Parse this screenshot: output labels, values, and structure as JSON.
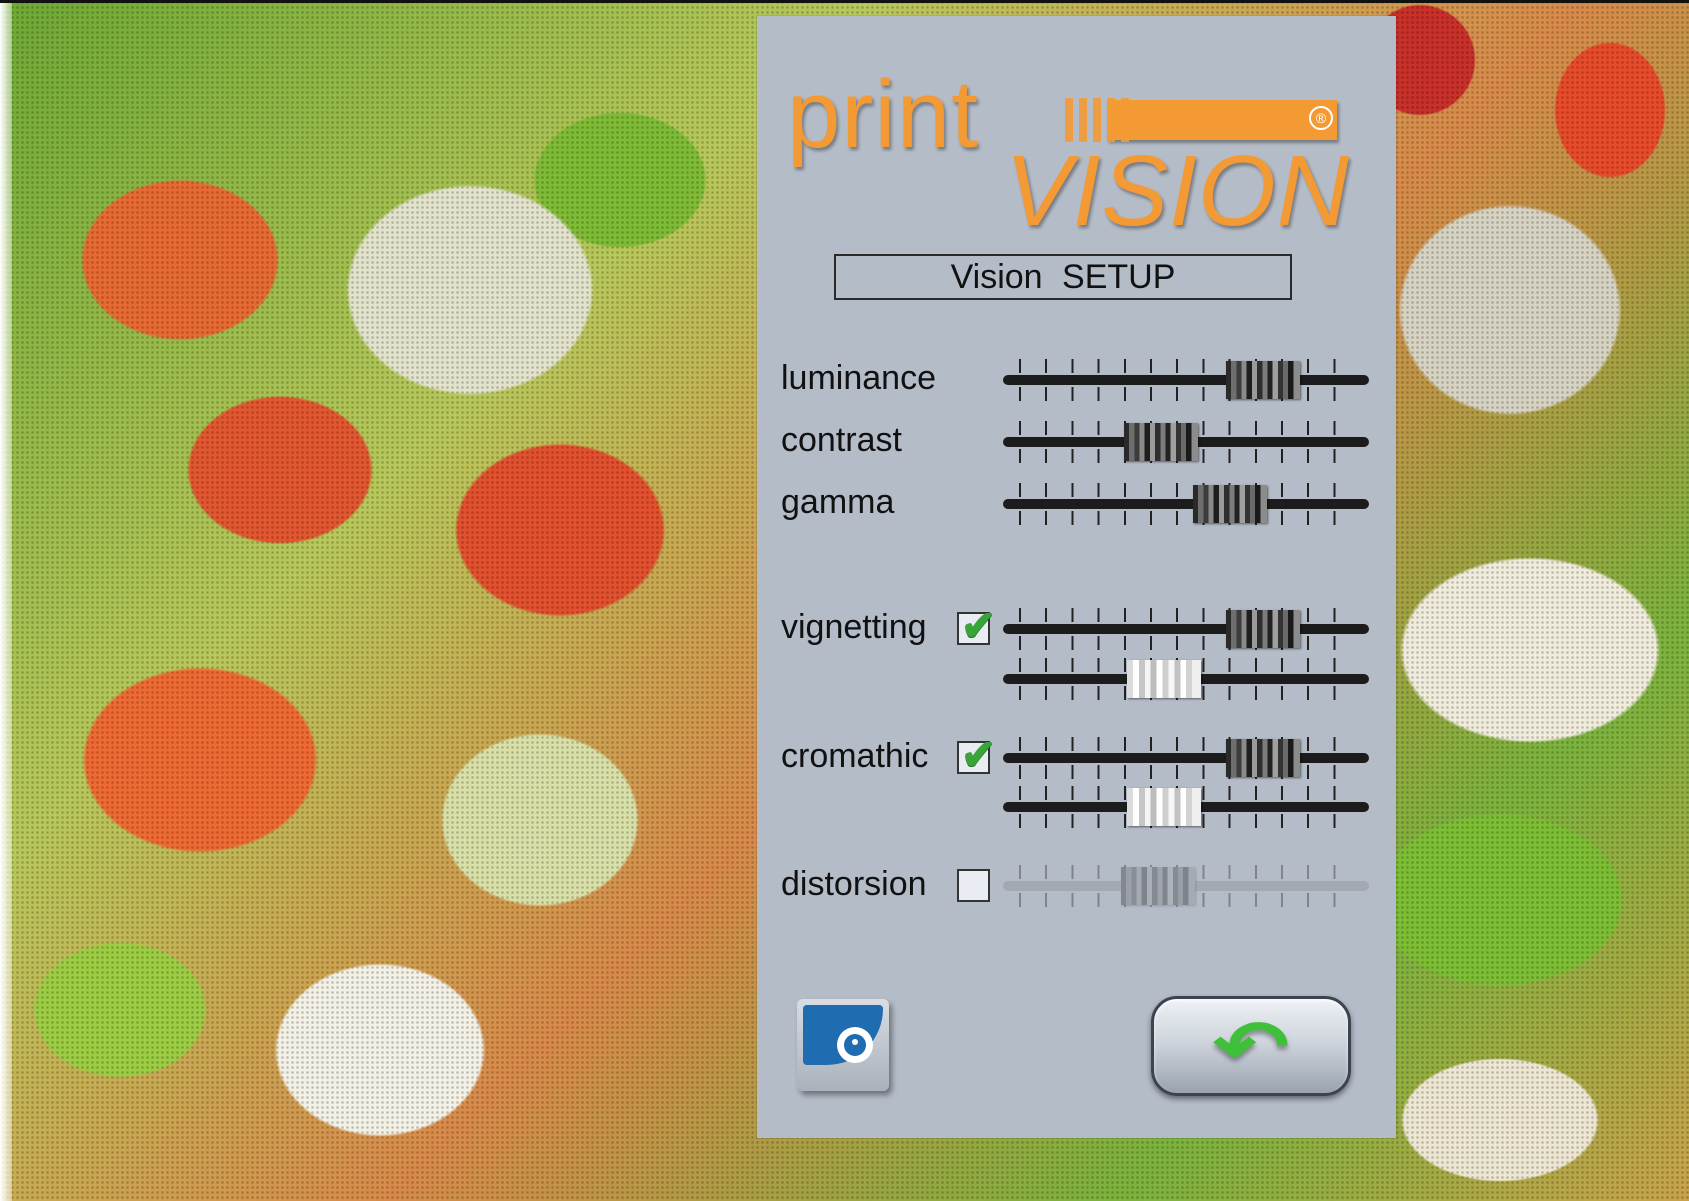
{
  "panel": {
    "logo": {
      "print": "print",
      "vision": "VISION",
      "registered": "®",
      "brand_color": "#f39a34"
    },
    "title": "Vision SETUP",
    "rows": {
      "luminance": {
        "label": "luminance",
        "value": 0.78
      },
      "contrast": {
        "label": "contrast",
        "value": 0.41
      },
      "gamma": {
        "label": "gamma",
        "value": 0.66
      },
      "vignetting": {
        "label": "vignetting",
        "checked": true,
        "value_1": 0.78,
        "value_2": 0.42
      },
      "cromathic": {
        "label": "cromathic",
        "checked": true,
        "value_1": 0.78,
        "value_2": 0.42
      },
      "distorsion": {
        "label": "distorsion",
        "checked": false,
        "value": 0.4
      }
    },
    "buttons": {
      "eye_icon": "eye-icon",
      "back_icon": "back-arrow-icon",
      "back_arrow_glyph": "↶"
    },
    "checkmark_glyph": "✔"
  },
  "colors": {
    "panel_bg": "#b4bcc8",
    "check_green": "#39a43a",
    "eye_blue": "#1f6cb0"
  }
}
